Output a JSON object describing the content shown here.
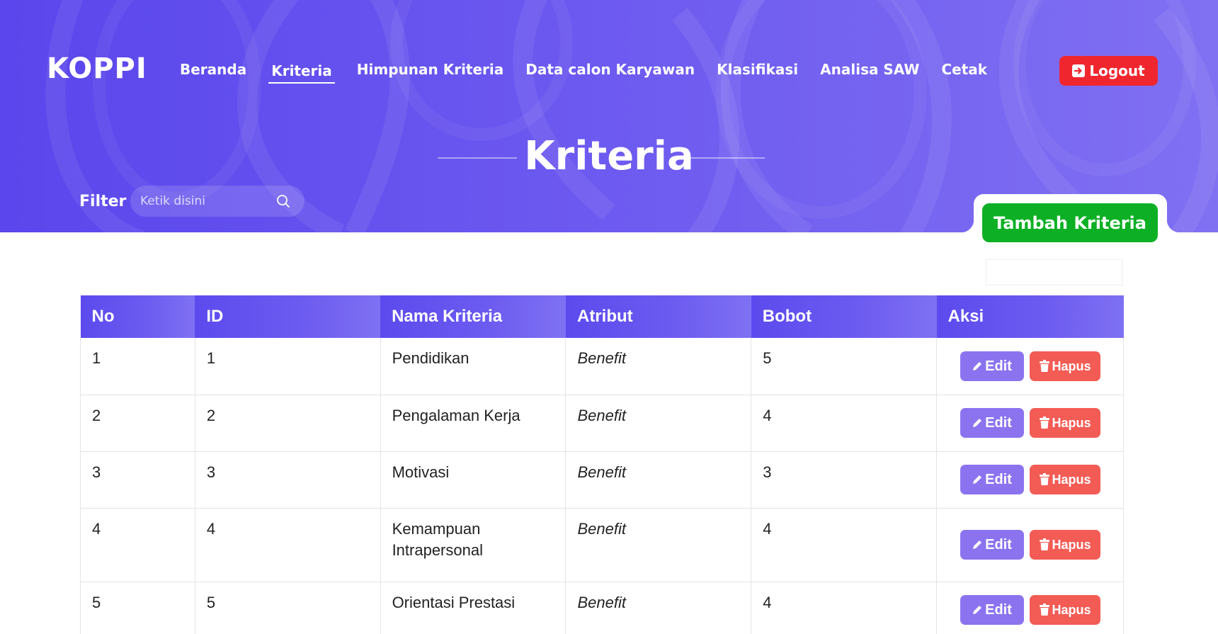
{
  "brand": {
    "logo": "KOPPI"
  },
  "nav": {
    "items": [
      {
        "label": "Beranda",
        "active": false
      },
      {
        "label": "Kriteria",
        "active": true
      },
      {
        "label": "Himpunan Kriteria",
        "active": false
      },
      {
        "label": "Data calon Karyawan",
        "active": false
      },
      {
        "label": "Klasifikasi",
        "active": false
      },
      {
        "label": "Analisa SAW",
        "active": false
      },
      {
        "label": "Cetak",
        "active": false
      }
    ],
    "logout_label": "Logout"
  },
  "page": {
    "title": "Kriteria"
  },
  "filter": {
    "label": "Filter",
    "placeholder": "Ketik disini"
  },
  "actions": {
    "add_label": "Tambah Kriteria"
  },
  "table": {
    "headers": [
      "No",
      "ID",
      "Nama Kriteria",
      "Atribut",
      "Bobot",
      "Aksi"
    ],
    "rows": [
      {
        "no": "1",
        "id": "1",
        "nama": "Pendidikan",
        "atribut": "Benefit",
        "bobot": "5"
      },
      {
        "no": "2",
        "id": "2",
        "nama": "Pengalaman Kerja",
        "atribut": "Benefit",
        "bobot": "4"
      },
      {
        "no": "3",
        "id": "3",
        "nama": "Motivasi",
        "atribut": "Benefit",
        "bobot": "3"
      },
      {
        "no": "4",
        "id": "4",
        "nama": "Kemampuan Intrapersonal",
        "atribut": "Benefit",
        "bobot": "4"
      },
      {
        "no": "5",
        "id": "5",
        "nama": "Orientasi Prestasi",
        "atribut": "Benefit",
        "bobot": "4"
      }
    ],
    "edit_label": "Edit",
    "hapus_label": "Hapus"
  },
  "colors": {
    "primary": "#5a46ec",
    "logout": "#f0262f",
    "add": "#0db024",
    "edit": "#8b73ef",
    "hapus": "#f35b55"
  },
  "icons": {
    "logout": "logout-arrow-icon",
    "search": "search-icon",
    "edit": "pencil-icon",
    "hapus": "trash-icon"
  }
}
